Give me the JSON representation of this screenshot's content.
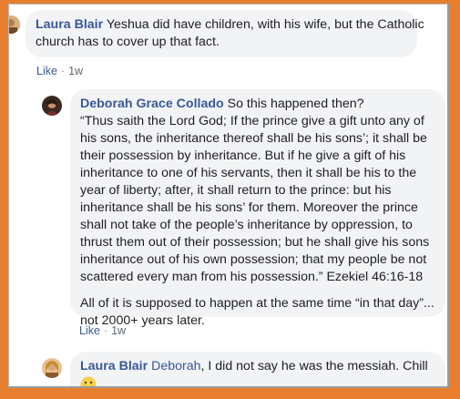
{
  "comments": [
    {
      "author": "Laura Blair",
      "text": "Yeshua did have children, with his wife, but the Catholic church has to cover up that fact.",
      "lines": [
        "Yeshua did have children, with his wife, but the Catholic",
        "church has to cover up that fact."
      ],
      "like_label": "Like",
      "time": "1w"
    },
    {
      "author": "Deborah Grace Collado",
      "intro": "So this happened then?",
      "lines": [
        "“Thus saith the Lord God; If the prince give a gift unto any of",
        "his sons, the inheritance thereof shall be his sons’; it shall be",
        "their possession by inheritance. But if he give a gift of his",
        "inheritance to one of his servants, then it shall be his to the",
        "year of liberty; after, it shall return to the prince: but his",
        "inheritance shall be his sons’ for them. Moreover the prince",
        "shall not take of the people’s inheritance by oppression, to",
        "thrust them out of their possession; but he shall give his sons",
        "inheritance out of his own possession; that my people be not",
        "scattered every man from his possession.” Ezekiel 46:16-18"
      ],
      "para2_lines": [
        "All of it is supposed to happen at the same time “in that day”...",
        "not 2000+ years later."
      ],
      "like_label": "Like",
      "time": "1w"
    },
    {
      "author": "Laura Blair",
      "mention": "Deborah",
      "text": ", I did not say he was the messiah. Chill",
      "emoji": "smiley-emoji"
    }
  ],
  "colors": {
    "frame": "#e67e2e",
    "link": "#385898",
    "bubble": "#f2f3f5",
    "meta": "#606770"
  }
}
